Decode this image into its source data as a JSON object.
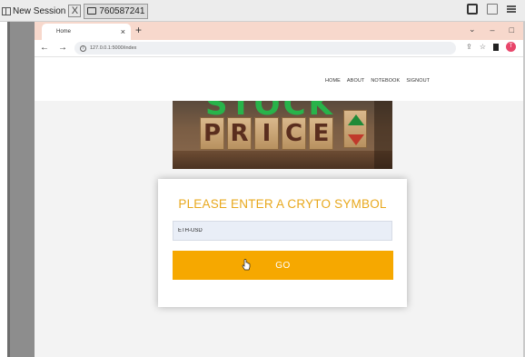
{
  "session": {
    "label": "New Session",
    "tab_close": "X",
    "tab_label": "760587241"
  },
  "browser": {
    "tab_title": "Home",
    "tab_close": "×",
    "new_tab": "+",
    "win_collapse": "⌄",
    "win_minimize": "–",
    "win_restore": "□",
    "back": "←",
    "forward": "→",
    "reload": "✕",
    "url": "127.0.0.1:5000/index",
    "share": "⇪",
    "bookmark": "☆",
    "profile_initial": "T"
  },
  "nav": {
    "items": [
      "HOME",
      "ABOUT",
      "NOTEBOOK",
      "SIGNOUT"
    ]
  },
  "hero": {
    "top_word": "STOCK",
    "letters": [
      "P",
      "R",
      "I",
      "C",
      "E"
    ]
  },
  "form": {
    "title": "PLEASE ENTER A CRYTO SYMBOL",
    "symbol_value": "ETH-USD",
    "go_label": "GO"
  },
  "colors": {
    "accent": "#f6a800",
    "title_gold": "#e8a81d",
    "tabstrip": "#f7d8cc",
    "profile": "#e8466b"
  }
}
